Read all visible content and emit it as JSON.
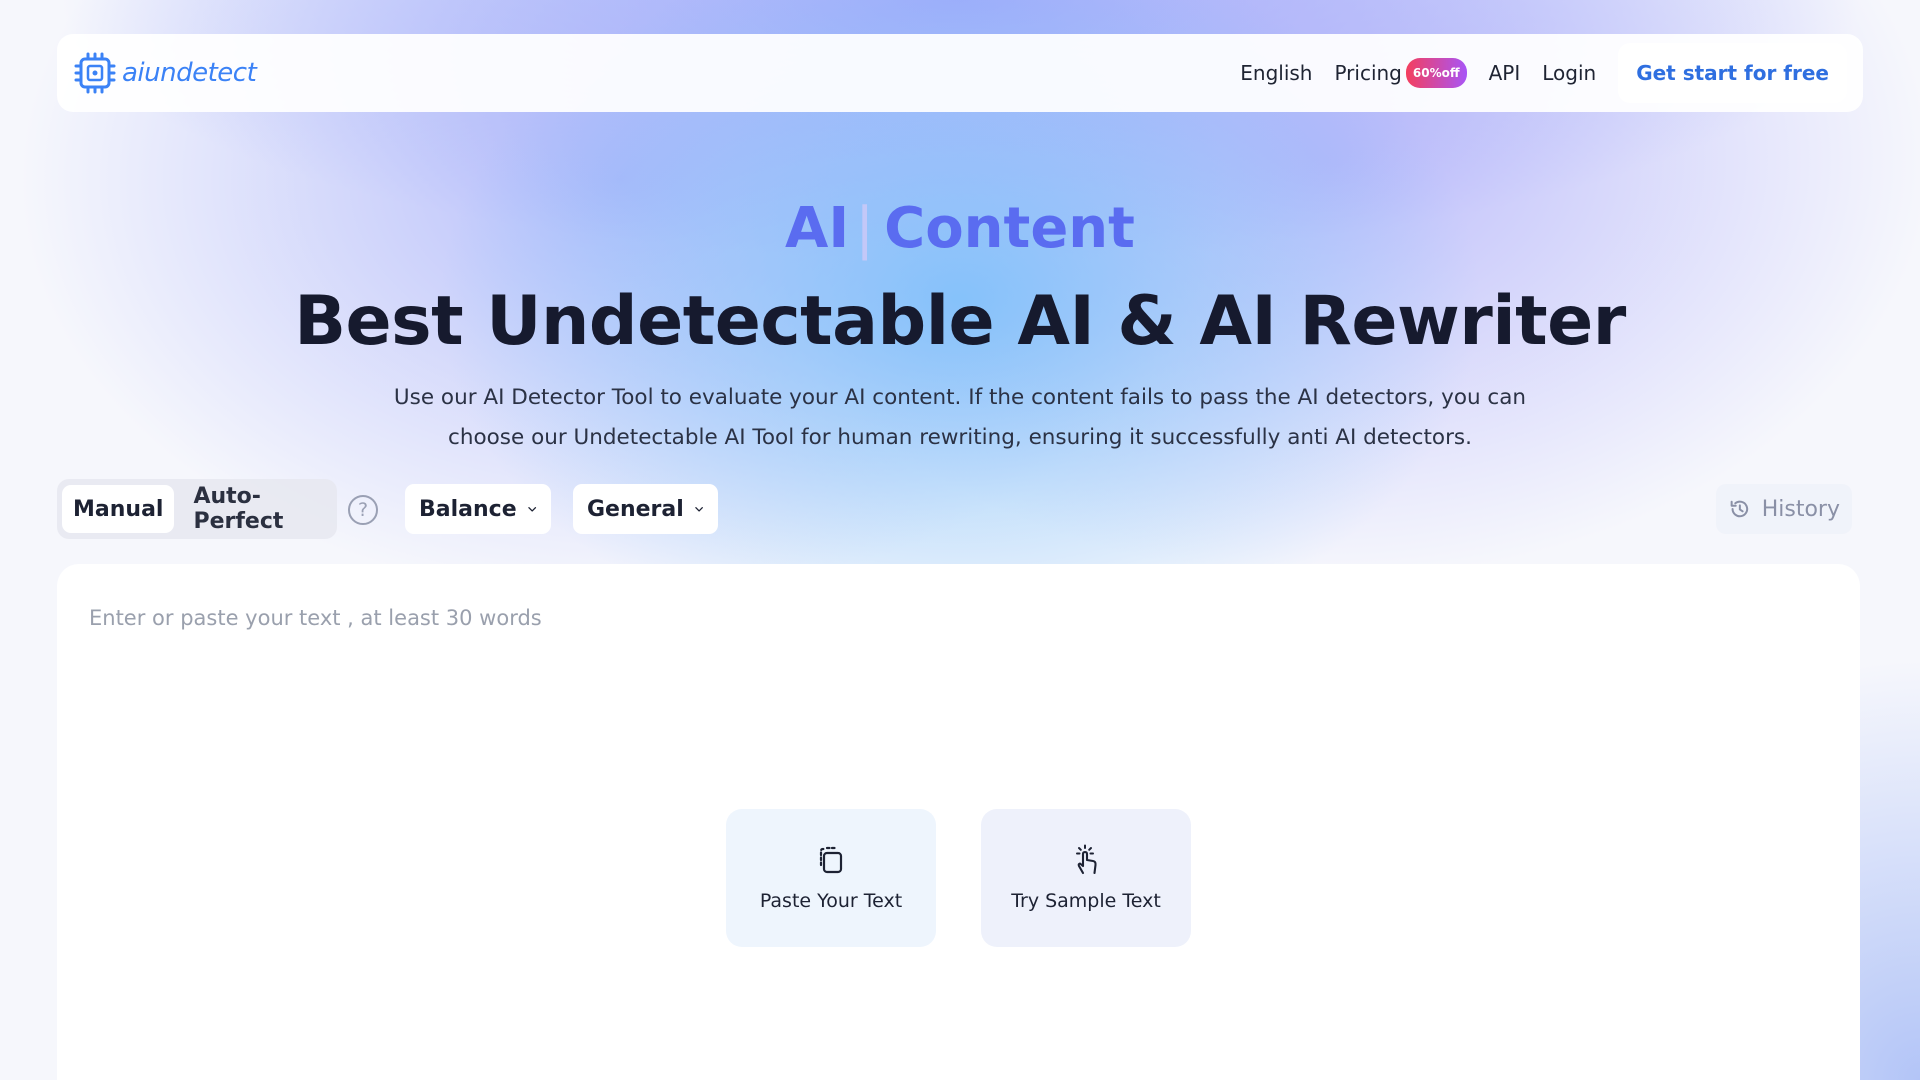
{
  "nav": {
    "logo_text": "aiundetect",
    "links": {
      "language": "English",
      "pricing": "Pricing",
      "pricing_badge": "60%off",
      "api": "API",
      "login": "Login"
    },
    "cta": "Get start for free"
  },
  "hero": {
    "eyebrow_left": "AI",
    "eyebrow_cursor": "|",
    "eyebrow_right": "Content",
    "headline": "Best Undetectable AI & AI Rewriter",
    "subtext": "Use our AI Detector Tool to evaluate your AI content. If the content fails to pass the AI detectors, you can choose our Undetectable AI Tool for human rewriting, ensuring it successfully anti AI detectors."
  },
  "toolbar": {
    "modes": [
      {
        "label": "Manual",
        "active": true
      },
      {
        "label": "Auto-Perfect",
        "active": false
      }
    ],
    "help_glyph": "?",
    "mode_dropdown": "Balance",
    "purpose_dropdown": "General",
    "history": "History"
  },
  "editor": {
    "placeholder": "Enter or paste your text , at least 30 words",
    "value": "",
    "paste_label": "Paste Your Text",
    "sample_label": "Try Sample Text"
  },
  "icons": {
    "logo": "chip-logo-icon",
    "help": "question-circle-icon",
    "dropdown": "chevron-down-icon",
    "history": "history-clock-icon",
    "paste": "clipboard-paste-icon",
    "sample": "hand-tap-icon"
  },
  "colors": {
    "brand_blue": "#3b82f6",
    "eyebrow": "#5a6cf0",
    "cta_text": "#2f6fe0",
    "badge_start": "#f43f5e",
    "badge_end": "#a855f7"
  }
}
